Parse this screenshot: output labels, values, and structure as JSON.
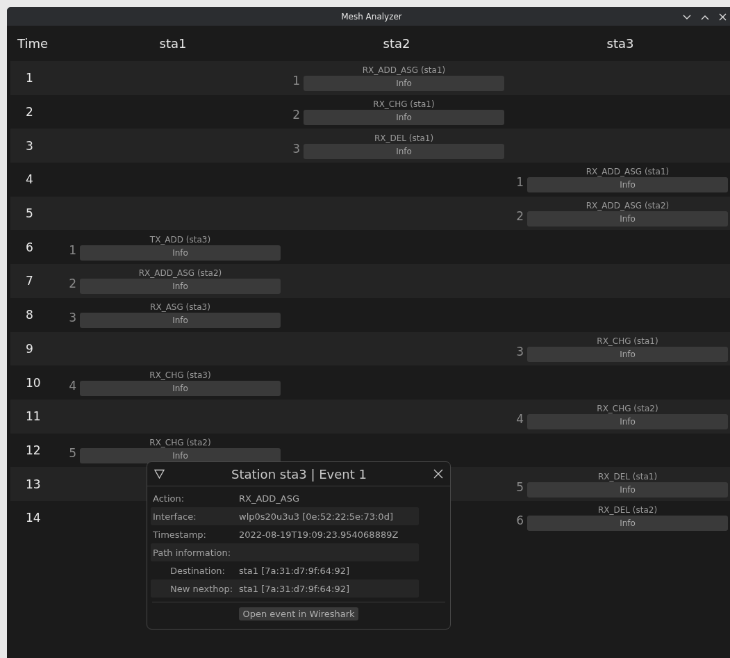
{
  "window": {
    "title": "Mesh Analyzer"
  },
  "table": {
    "columns": [
      "Time",
      "sta1",
      "sta2",
      "sta3"
    ],
    "rows": [
      {
        "cells": [
          {
            "kind": "time",
            "text": "1"
          },
          {
            "kind": "empty"
          },
          {
            "kind": "event",
            "number": "1",
            "label": "RX_ADD_ASG (sta1)",
            "button": "Info"
          },
          {
            "kind": "empty"
          }
        ]
      },
      {
        "cells": [
          {
            "kind": "time",
            "text": "2"
          },
          {
            "kind": "empty"
          },
          {
            "kind": "event",
            "number": "2",
            "label": "RX_CHG (sta1)",
            "button": "Info"
          },
          {
            "kind": "empty"
          }
        ]
      },
      {
        "cells": [
          {
            "kind": "time",
            "text": "3"
          },
          {
            "kind": "empty"
          },
          {
            "kind": "event",
            "number": "3",
            "label": "RX_DEL (sta1)",
            "button": "Info"
          },
          {
            "kind": "empty"
          }
        ]
      },
      {
        "cells": [
          {
            "kind": "time",
            "text": "4"
          },
          {
            "kind": "empty"
          },
          {
            "kind": "empty"
          },
          {
            "kind": "event",
            "number": "1",
            "label": "RX_ADD_ASG (sta1)",
            "button": "Info"
          }
        ]
      },
      {
        "cells": [
          {
            "kind": "time",
            "text": "5"
          },
          {
            "kind": "empty"
          },
          {
            "kind": "empty"
          },
          {
            "kind": "event",
            "number": "2",
            "label": "RX_ADD_ASG (sta2)",
            "button": "Info"
          }
        ]
      },
      {
        "cells": [
          {
            "kind": "time",
            "text": "6"
          },
          {
            "kind": "event",
            "number": "1",
            "label": "TX_ADD (sta3)",
            "button": "Info"
          },
          {
            "kind": "empty"
          },
          {
            "kind": "empty"
          }
        ]
      },
      {
        "cells": [
          {
            "kind": "time",
            "text": "7"
          },
          {
            "kind": "event",
            "number": "2",
            "label": "RX_ADD_ASG (sta2)",
            "button": "Info"
          },
          {
            "kind": "empty"
          },
          {
            "kind": "empty"
          }
        ]
      },
      {
        "cells": [
          {
            "kind": "time",
            "text": "8"
          },
          {
            "kind": "event",
            "number": "3",
            "label": "RX_ASG (sta3)",
            "button": "Info"
          },
          {
            "kind": "empty"
          },
          {
            "kind": "empty"
          }
        ]
      },
      {
        "cells": [
          {
            "kind": "time",
            "text": "9"
          },
          {
            "kind": "empty"
          },
          {
            "kind": "empty"
          },
          {
            "kind": "event",
            "number": "3",
            "label": "RX_CHG (sta1)",
            "button": "Info"
          }
        ]
      },
      {
        "cells": [
          {
            "kind": "time",
            "text": "10"
          },
          {
            "kind": "event",
            "number": "4",
            "label": "RX_CHG (sta3)",
            "button": "Info"
          },
          {
            "kind": "empty"
          },
          {
            "kind": "empty"
          }
        ]
      },
      {
        "cells": [
          {
            "kind": "time",
            "text": "11"
          },
          {
            "kind": "empty"
          },
          {
            "kind": "empty"
          },
          {
            "kind": "event",
            "number": "4",
            "label": "RX_CHG (sta2)",
            "button": "Info"
          }
        ]
      },
      {
        "cells": [
          {
            "kind": "time",
            "text": "12"
          },
          {
            "kind": "event",
            "number": "5",
            "label": "RX_CHG (sta2)",
            "button": "Info"
          },
          {
            "kind": "empty"
          },
          {
            "kind": "empty"
          }
        ]
      },
      {
        "cells": [
          {
            "kind": "time",
            "text": "13"
          },
          {
            "kind": "empty"
          },
          {
            "kind": "empty"
          },
          {
            "kind": "event",
            "number": "5",
            "label": "RX_DEL (sta1)",
            "button": "Info"
          }
        ]
      },
      {
        "cells": [
          {
            "kind": "time",
            "text": "14"
          },
          {
            "kind": "empty"
          },
          {
            "kind": "empty"
          },
          {
            "kind": "event",
            "number": "6",
            "label": "RX_DEL (sta2)",
            "button": "Info"
          }
        ]
      }
    ]
  },
  "popup": {
    "title": "Station sta3 | Event 1",
    "fields": [
      {
        "label": "Action:",
        "value": "RX_ADD_ASG"
      },
      {
        "label": "Interface:",
        "value": "wlp0s20u3u3 [0e:52:22:5e:73:0d]"
      },
      {
        "label": "Timestamp:",
        "value": "2022-08-19T19:09:23.954068889Z"
      },
      {
        "label": "Path information:",
        "children": [
          {
            "label": "Destination:",
            "value": "sta1 [7a:31:d7:9f:64:92]"
          },
          {
            "label": "New nexthop:",
            "value": "sta1 [7a:31:d7:9f:64:92]"
          }
        ]
      }
    ],
    "button": "Open event in Wireshark"
  }
}
